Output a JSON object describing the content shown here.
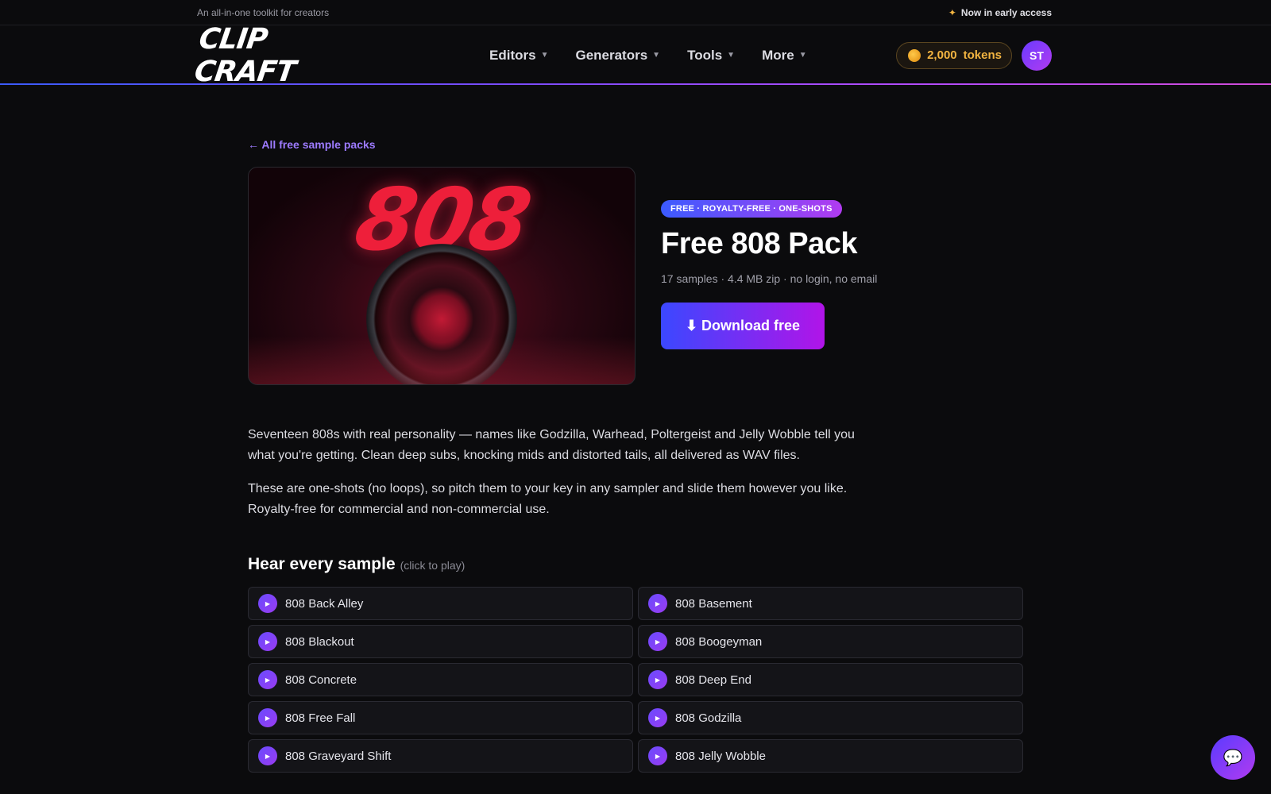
{
  "topbar": {
    "tagline": "An all-in-one toolkit for creators",
    "early_access": "Now in early access"
  },
  "nav": {
    "logo": "CLIP CRAFT",
    "menu": [
      {
        "label": "Editors"
      },
      {
        "label": "Generators"
      },
      {
        "label": "Tools"
      },
      {
        "label": "More"
      }
    ],
    "tokens_value": "2,000",
    "tokens_label": "tokens",
    "avatar_initials": "ST"
  },
  "back_link": "← All free sample packs",
  "cover_text": "808",
  "badge": "FREE · ROYALTY-FREE · ONE-SHOTS",
  "title": "Free 808 Pack",
  "meta": "17 samples · 4.4 MB zip · no login, no email",
  "download_label": "⬇ Download free",
  "description": [
    "Seventeen 808s with real personality — names like Godzilla, Warhead, Poltergeist and Jelly Wobble tell you what you're getting. Clean deep subs, knocking mids and distorted tails, all delivered as WAV files.",
    "These are one-shots (no loops), so pitch them to your key in any sampler and slide them however you like. Royalty-free for commercial and non-commercial use."
  ],
  "samples_heading": "Hear every sample",
  "samples_hint": "(click to play)",
  "samples": [
    "808 Back Alley",
    "808 Basement",
    "808 Blackout",
    "808 Boogeyman",
    "808 Concrete",
    "808 Deep End",
    "808 Free Fall",
    "808 Godzilla",
    "808 Graveyard Shift",
    "808 Jelly Wobble"
  ],
  "colors": {
    "accent": "#9d7bff",
    "token_gold": "#f2b441",
    "gradient_start": "#3b48ff",
    "gradient_end": "#b114e8"
  }
}
